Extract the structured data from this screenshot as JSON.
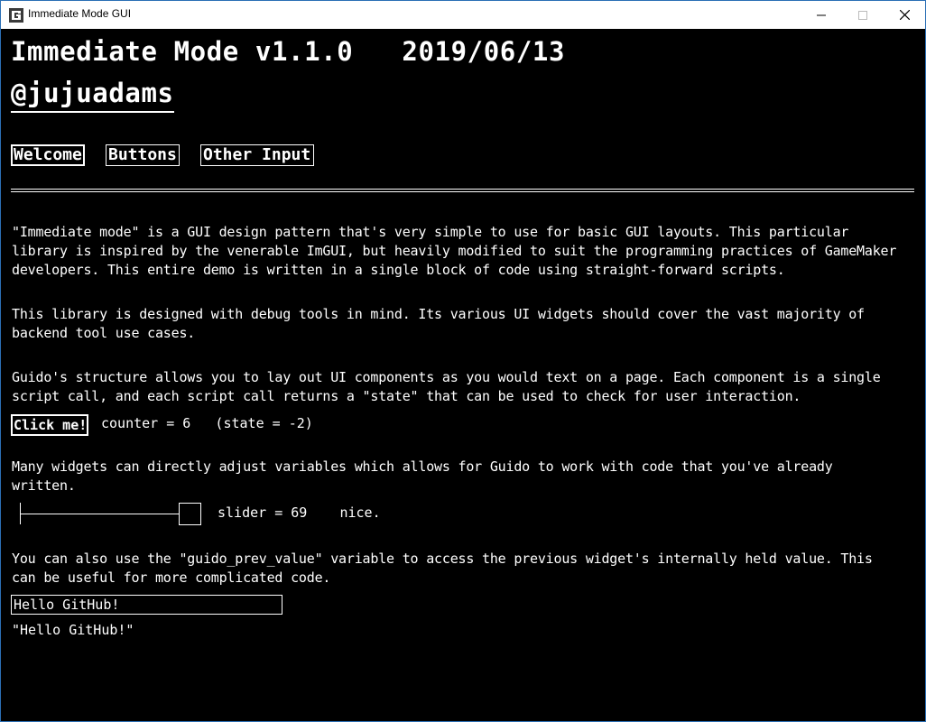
{
  "window": {
    "title": "Immediate Mode GUI",
    "icon": "gamemaker-icon",
    "controls": [
      "minimize-icon",
      "maximize-icon",
      "close-icon"
    ]
  },
  "header": {
    "version_line": "Immediate Mode v1.1.0   2019/06/13",
    "author": "@jujuadams"
  },
  "tabs": [
    {
      "label": "Welcome",
      "active": true
    },
    {
      "label": "Buttons",
      "active": false
    },
    {
      "label": "Other Input",
      "active": false
    }
  ],
  "paragraphs": {
    "intro": "\"Immediate mode\" is a GUI design pattern that's very simple to use for basic GUI layouts. This particular\nlibrary is inspired by the venerable ImGUI, but heavily modified to suit the programming practices of GameMaker\ndevelopers. This entire demo is written in a single block of code using straight-forward scripts.",
    "debug": "This library is designed with debug tools in mind. Its various UI widgets should cover the vast majority of\nbackend tool use cases.",
    "structure": "Guido's structure allows you to lay out UI components as you would text on a page. Each component is a single\nscript call, and each script call returns a \"state\" that can be used to check for user interaction.",
    "widgets": "Many widgets can directly adjust variables which allows for Guido to work with code that you've already\nwritten.",
    "prev_value": "You can also use the \"guido_prev_value\" variable to access the previous widget's internally held value. This\ncan be useful for more complicated code."
  },
  "button_demo": {
    "button_label": "Click me!",
    "counter_text": "counter = 6   (state = -2)"
  },
  "slider_demo": {
    "value": 69,
    "text": "slider = 69    nice."
  },
  "input_demo": {
    "value": "Hello GitHub!",
    "echo": "\"Hello GitHub!\""
  }
}
